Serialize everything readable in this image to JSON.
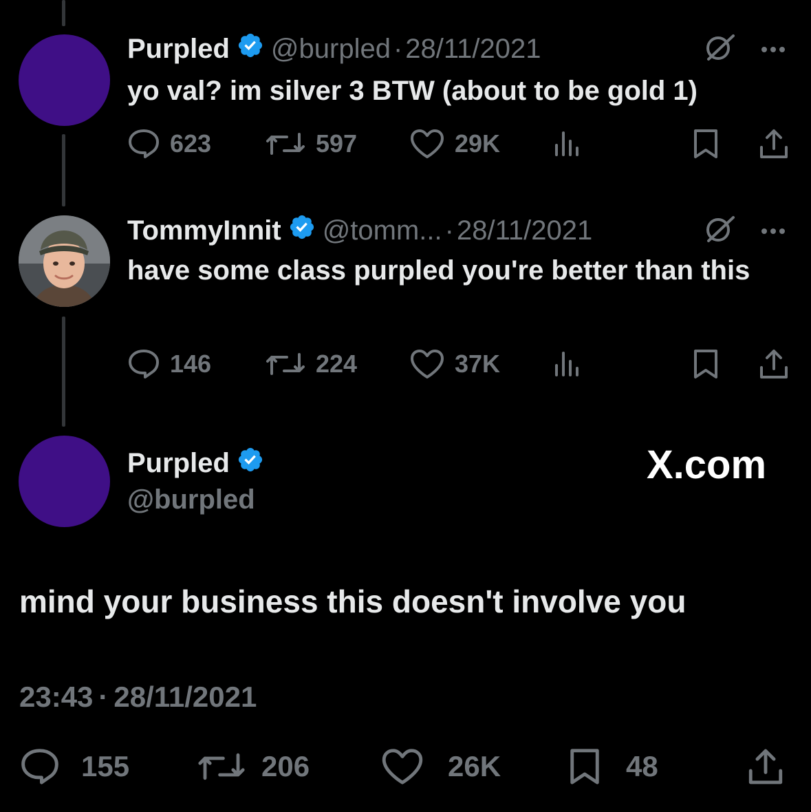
{
  "brand": {
    "watermark": "X.com"
  },
  "colors": {
    "background": "#000000",
    "text": "#e7e9ea",
    "muted": "#71767b",
    "verified": "#1d9bf0",
    "avatar_purple": "#3f0f86"
  },
  "tweets": [
    {
      "name": "Purpled",
      "handle": "@burpled",
      "separator": "·",
      "date": "28/11/2021",
      "text": "yo val? im silver 3 BTW (about to be gold 1)",
      "replies": "623",
      "retweets": "597",
      "likes": "29K",
      "icons": [
        "verified-badge-icon",
        "grok-icon",
        "more-icon",
        "reply-icon",
        "retweet-icon",
        "like-icon",
        "views-icon",
        "bookmark-icon",
        "share-icon"
      ]
    },
    {
      "name": "TommyInnit",
      "handle": "@tomm...",
      "separator": "·",
      "date": "28/11/2021",
      "text": "have some class purpled you're better than this",
      "replies": "146",
      "retweets": "224",
      "likes": "37K"
    }
  ],
  "main_tweet": {
    "name": "Purpled",
    "handle": "@burpled",
    "text": "mind your business this doesn't involve you",
    "time": "23:43",
    "separator": "·",
    "date": "28/11/2021",
    "replies": "155",
    "retweets": "206",
    "likes": "26K",
    "bookmarks": "48"
  }
}
